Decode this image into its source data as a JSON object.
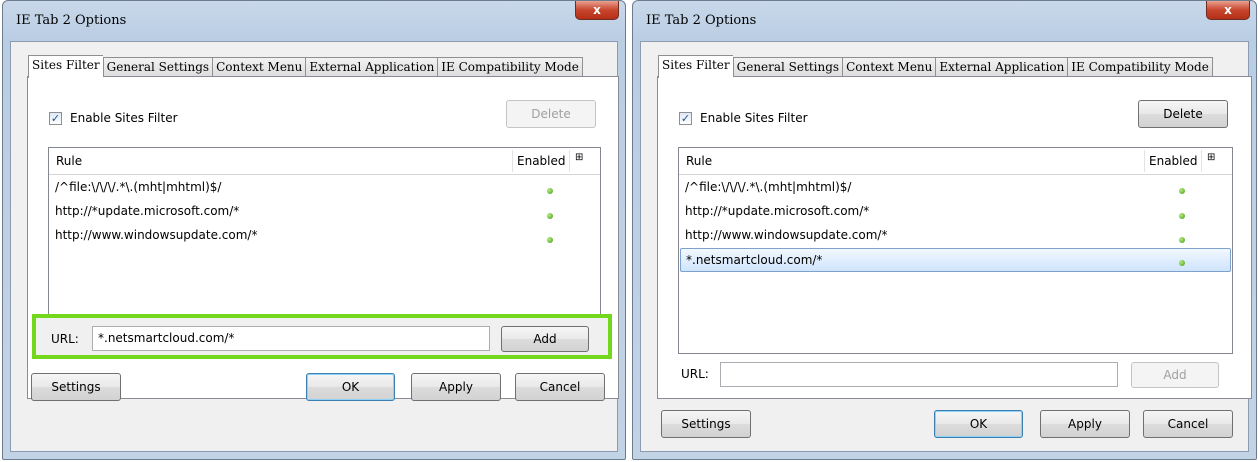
{
  "dialogs": [
    {
      "title": "IE Tab 2 Options",
      "close_glyph": "x",
      "tabs": [
        "Sites Filter",
        "General Settings",
        "Context Menu",
        "External Application",
        "IE Compatibility Mode"
      ],
      "enable_label": "Enable Sites Filter",
      "enable_checked": "✓",
      "delete_label": "Delete",
      "col_rule": "Rule",
      "col_enabled": "Enabled",
      "col_icon": "⊞",
      "rules": [
        "/^file:\\/\\/\\/.*\\.(mht|mhtml)$/",
        "http://*update.microsoft.com/*",
        "http://www.windowsupdate.com/*"
      ],
      "url_label": "URL:",
      "url_value": "*.netsmartcloud.com/*",
      "add_label": "Add",
      "settings_label": "Settings",
      "ok_label": "OK",
      "apply_label": "Apply",
      "cancel_label": "Cancel"
    },
    {
      "title": "IE Tab 2 Options",
      "close_glyph": "x",
      "tabs": [
        "Sites Filter",
        "General Settings",
        "Context Menu",
        "External Application",
        "IE Compatibility Mode"
      ],
      "enable_label": "Enable Sites Filter",
      "enable_checked": "✓",
      "delete_label": "Delete",
      "col_rule": "Rule",
      "col_enabled": "Enabled",
      "col_icon": "⊞",
      "rules": [
        "/^file:\\/\\/\\/.*\\.(mht|mhtml)$/",
        "http://*update.microsoft.com/*",
        "http://www.windowsupdate.com/*",
        "*.netsmartcloud.com/*"
      ],
      "url_label": "URL:",
      "url_value": "",
      "add_label": "Add",
      "settings_label": "Settings",
      "ok_label": "OK",
      "apply_label": "Apply",
      "cancel_label": "Cancel"
    }
  ],
  "colors": {
    "highlight_border": "#73d81c",
    "enabled_dot": "#3c9a1c"
  }
}
